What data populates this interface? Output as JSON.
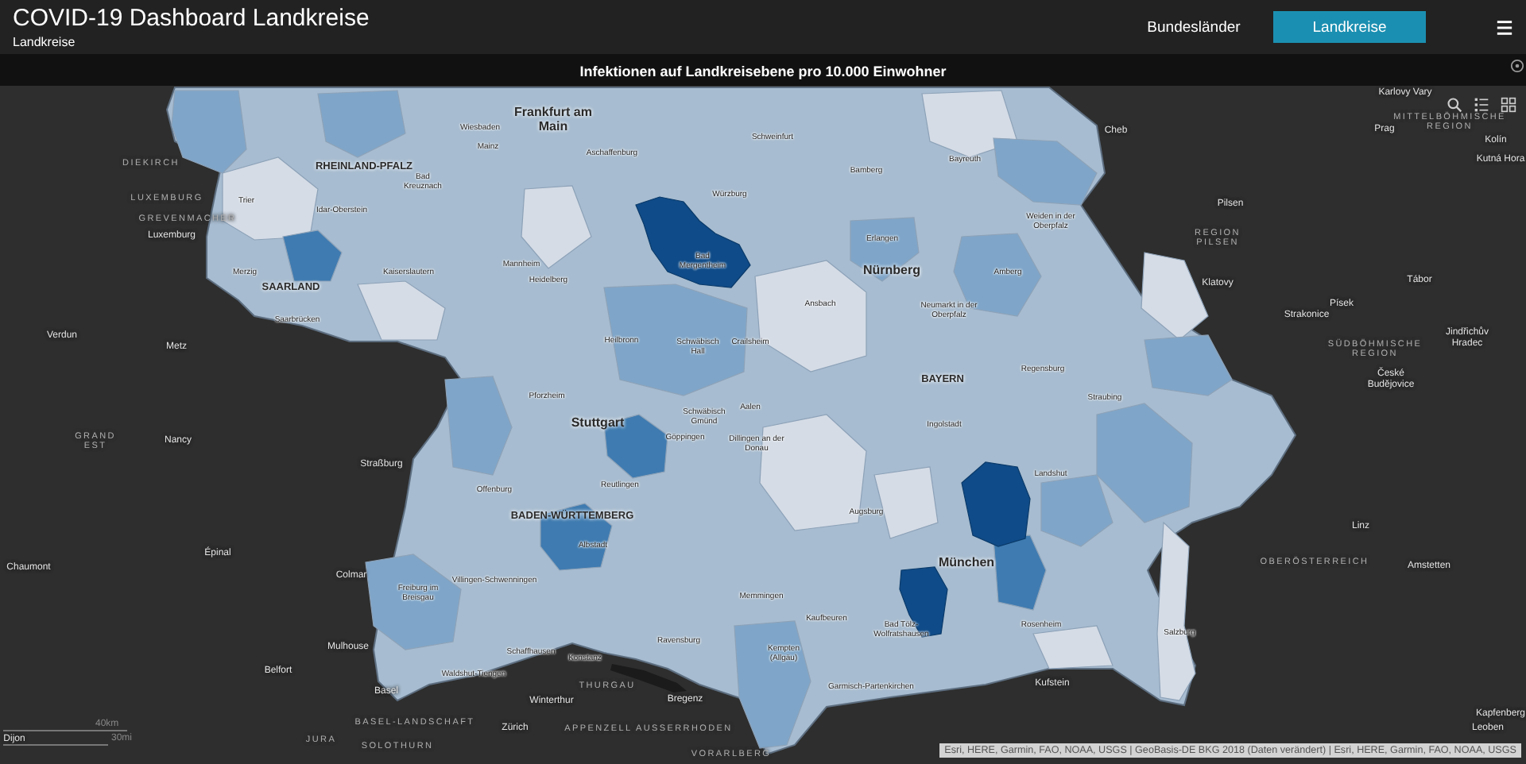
{
  "header": {
    "title": "COVID-19 Dashboard Landkreise",
    "subtitle": "Landkreise"
  },
  "tabs": [
    {
      "label": "Bundesländer",
      "selected": false
    },
    {
      "label": "Landkreise",
      "selected": true
    }
  ],
  "panel": {
    "title": "Infektionen auf Landkreisebene pro 10.000 Einwohner"
  },
  "map": {
    "labels": [
      {
        "text": "Karlovy Vary",
        "kind": "city"
      },
      {
        "text": "Cheb",
        "kind": "city"
      },
      {
        "text": "Prag",
        "kind": "city"
      },
      {
        "text": "Kolín",
        "kind": "city"
      },
      {
        "text": "Kutná Hora",
        "kind": "city"
      },
      {
        "text": "Pilsen",
        "kind": "city"
      },
      {
        "text": "Luxemburg",
        "kind": "city"
      },
      {
        "text": "Tábor",
        "kind": "city"
      },
      {
        "text": "Klatovy",
        "kind": "city"
      },
      {
        "text": "Písek",
        "kind": "city"
      },
      {
        "text": "Strakonice",
        "kind": "city"
      },
      {
        "text": "Verdun",
        "kind": "city"
      },
      {
        "text": "Jindřichův Hradec",
        "kind": "city"
      },
      {
        "text": "Metz",
        "kind": "city"
      },
      {
        "text": "České Budějovice",
        "kind": "city"
      },
      {
        "text": "Nancy",
        "kind": "city"
      },
      {
        "text": "Straßburg",
        "kind": "city"
      },
      {
        "text": "Linz",
        "kind": "city"
      },
      {
        "text": "Épinal",
        "kind": "city"
      },
      {
        "text": "Chaumont",
        "kind": "city"
      },
      {
        "text": "Amstetten",
        "kind": "city"
      },
      {
        "text": "Colmar",
        "kind": "city"
      },
      {
        "text": "Salzburg",
        "kind": "district"
      },
      {
        "text": "Mulhouse",
        "kind": "city"
      },
      {
        "text": "Belfort",
        "kind": "city"
      },
      {
        "text": "Kufstein",
        "kind": "city"
      },
      {
        "text": "Basel",
        "kind": "city"
      },
      {
        "text": "Bregenz",
        "kind": "city"
      },
      {
        "text": "Winterthur",
        "kind": "city"
      },
      {
        "text": "Kapfenberg",
        "kind": "city"
      },
      {
        "text": "Zürich",
        "kind": "city"
      },
      {
        "text": "Leoben",
        "kind": "city"
      },
      {
        "text": "Dijon",
        "kind": "city"
      },
      {
        "text": "DIEKIRCH",
        "kind": "region"
      },
      {
        "text": "LUXEMBURG",
        "kind": "region"
      },
      {
        "text": "GREVENMACHER",
        "kind": "region"
      },
      {
        "text": "GRAND EST",
        "kind": "region"
      },
      {
        "text": "BASEL-LANDSCHAFT",
        "kind": "region"
      },
      {
        "text": "JURA",
        "kind": "region"
      },
      {
        "text": "SOLOTHURN",
        "kind": "region"
      },
      {
        "text": "THURGAU",
        "kind": "region"
      },
      {
        "text": "APPENZELL AUSSERRHODEN",
        "kind": "region"
      },
      {
        "text": "VORARLBERG",
        "kind": "region"
      },
      {
        "text": "REGION PILSEN",
        "kind": "region"
      },
      {
        "text": "MITTELBÖHMISCHE REGION",
        "kind": "region"
      },
      {
        "text": "SÜDBÖHMISCHE REGION",
        "kind": "region"
      },
      {
        "text": "OBERÖSTERREICH",
        "kind": "region"
      },
      {
        "text": "RHEINLAND-PFALZ",
        "kind": "state"
      },
      {
        "text": "SAARLAND",
        "kind": "state"
      },
      {
        "text": "BADEN-WÜRTTEMBERG",
        "kind": "state"
      },
      {
        "text": "BAYERN",
        "kind": "state"
      },
      {
        "text": "Frankfurt am Main",
        "kind": "major"
      },
      {
        "text": "Stuttgart",
        "kind": "major"
      },
      {
        "text": "Nürnberg",
        "kind": "major"
      },
      {
        "text": "München",
        "kind": "major"
      },
      {
        "text": "Bad Mergentheim",
        "kind": "district"
      },
      {
        "text": "Wiesbaden",
        "kind": "district"
      },
      {
        "text": "Mainz",
        "kind": "district"
      },
      {
        "text": "Aschaffenburg",
        "kind": "district"
      },
      {
        "text": "Schweinfurt",
        "kind": "district"
      },
      {
        "text": "Würzburg",
        "kind": "district"
      },
      {
        "text": "Bamberg",
        "kind": "district"
      },
      {
        "text": "Bayreuth",
        "kind": "district"
      },
      {
        "text": "Erlangen",
        "kind": "district"
      },
      {
        "text": "Weiden in der Oberpfalz",
        "kind": "district"
      },
      {
        "text": "Amberg",
        "kind": "district"
      },
      {
        "text": "Ansbach",
        "kind": "district"
      },
      {
        "text": "Neumarkt in der Oberpfalz",
        "kind": "district"
      },
      {
        "text": "Regensburg",
        "kind": "district"
      },
      {
        "text": "Straubing",
        "kind": "district"
      },
      {
        "text": "Ingolstadt",
        "kind": "district"
      },
      {
        "text": "Landshut",
        "kind": "district"
      },
      {
        "text": "Augsburg",
        "kind": "district"
      },
      {
        "text": "Memmingen",
        "kind": "district"
      },
      {
        "text": "Kaufbeuren",
        "kind": "district"
      },
      {
        "text": "Bad Tölz-Wolfratshausen",
        "kind": "district"
      },
      {
        "text": "Rosenheim",
        "kind": "district"
      },
      {
        "text": "Kempten (Allgäu)",
        "kind": "district"
      },
      {
        "text": "Garmisch-Partenkirchen",
        "kind": "district"
      },
      {
        "text": "Mannheim",
        "kind": "district"
      },
      {
        "text": "Heidelberg",
        "kind": "district"
      },
      {
        "text": "Heilbronn",
        "kind": "district"
      },
      {
        "text": "Schwäbisch Hall",
        "kind": "district"
      },
      {
        "text": "Crailsheim",
        "kind": "district"
      },
      {
        "text": "Pforzheim",
        "kind": "district"
      },
      {
        "text": "Schwäbisch Gmünd",
        "kind": "district"
      },
      {
        "text": "Aalen",
        "kind": "district"
      },
      {
        "text": "Göppingen",
        "kind": "district"
      },
      {
        "text": "Dillingen an der Donau",
        "kind": "district"
      },
      {
        "text": "Reutlingen",
        "kind": "district"
      },
      {
        "text": "Offenburg",
        "kind": "district"
      },
      {
        "text": "Albstadt",
        "kind": "district"
      },
      {
        "text": "Villingen-Schwenningen",
        "kind": "district"
      },
      {
        "text": "Freiburg im Breisgau",
        "kind": "district"
      },
      {
        "text": "Ravensburg",
        "kind": "district"
      },
      {
        "text": "Schaffhausen",
        "kind": "district"
      },
      {
        "text": "Konstanz",
        "kind": "district"
      },
      {
        "text": "Waldshut-Tiengen",
        "kind": "district"
      },
      {
        "text": "Bad Kreuznach",
        "kind": "district"
      },
      {
        "text": "Trier",
        "kind": "district"
      },
      {
        "text": "Idar-Oberstein",
        "kind": "district"
      },
      {
        "text": "Merzig",
        "kind": "district"
      },
      {
        "text": "Kaiserslautern",
        "kind": "district"
      },
      {
        "text": "Saarbrücken",
        "kind": "district"
      }
    ],
    "scale": [
      "40km",
      "30mi"
    ],
    "attribution": "Esri, HERE, Garmin, FAO, NOAA, USGS | GeoBasis-DE BKG 2018 (Daten verändert) | Esri, HERE, Garmin, FAO, NOAA, USGS"
  }
}
